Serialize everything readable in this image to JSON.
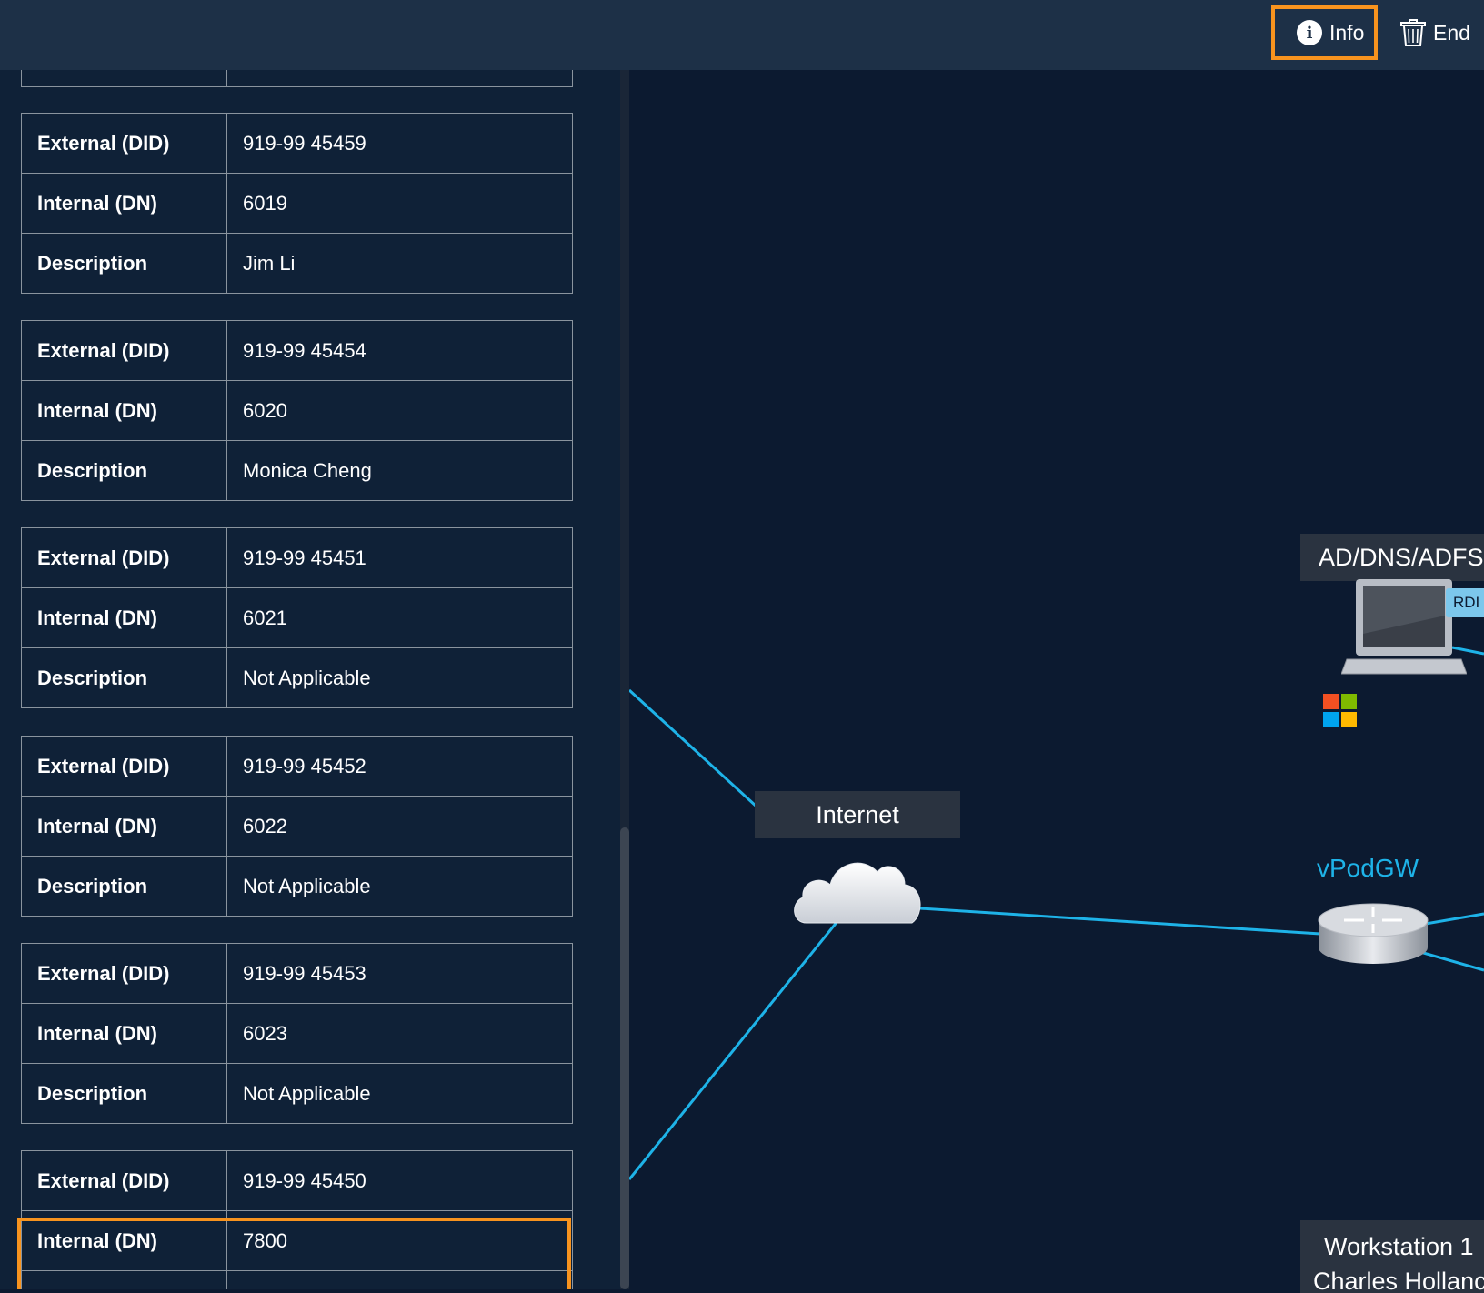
{
  "toolbar": {
    "info_label": "Info",
    "end_label": "End"
  },
  "tables": [
    {
      "rows": [
        {
          "label": "External (DID)",
          "value": "919-99 45459"
        },
        {
          "label": "Internal (DN)",
          "value": "6019"
        },
        {
          "label": "Description",
          "value": "Jim Li"
        }
      ]
    },
    {
      "rows": [
        {
          "label": "External (DID)",
          "value": "919-99 45454"
        },
        {
          "label": "Internal (DN)",
          "value": "6020"
        },
        {
          "label": "Description",
          "value": "Monica Cheng"
        }
      ]
    },
    {
      "rows": [
        {
          "label": "External (DID)",
          "value": "919-99 45451"
        },
        {
          "label": "Internal (DN)",
          "value": "6021"
        },
        {
          "label": "Description",
          "value": "Not Applicable"
        }
      ]
    },
    {
      "rows": [
        {
          "label": "External (DID)",
          "value": "919-99 45452"
        },
        {
          "label": "Internal (DN)",
          "value": "6022"
        },
        {
          "label": "Description",
          "value": "Not Applicable"
        }
      ]
    },
    {
      "rows": [
        {
          "label": "External (DID)",
          "value": "919-99 45453"
        },
        {
          "label": "Internal (DN)",
          "value": "6023"
        },
        {
          "label": "Description",
          "value": "Not Applicable"
        }
      ]
    },
    {
      "rows": [
        {
          "label": "External (DID)",
          "value": "919-99 45450"
        },
        {
          "label": "Internal (DN)",
          "value": "7800"
        }
      ]
    }
  ],
  "diagram": {
    "internet_label": "Internet",
    "vpodgw_label": "vPodGW",
    "ad_label": "AD/DNS/ADFS",
    "rdp_badge": "RDI",
    "workstation_label_line1": "Workstation 1",
    "workstation_label_line2": "Charles Hollanc",
    "link_color": "#1eb3e8",
    "highlight_color": "#f7931e"
  }
}
